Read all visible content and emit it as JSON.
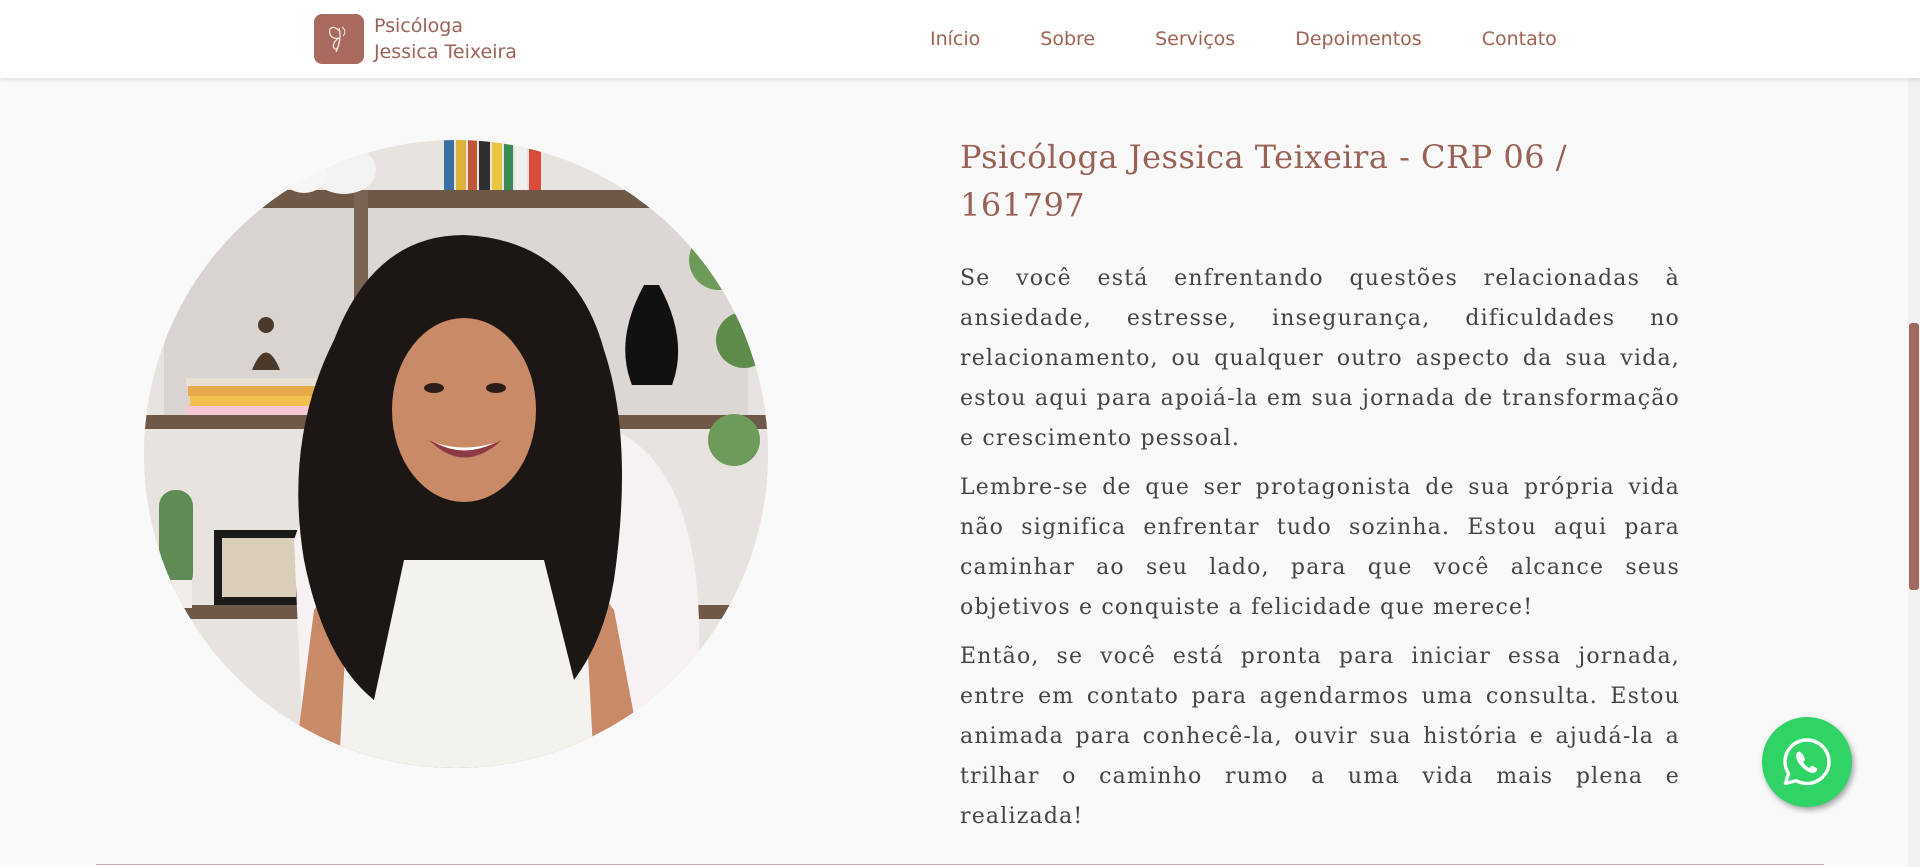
{
  "brand": {
    "line1": "Psicóloga",
    "line2": "Jessica Teixeira",
    "logo_icon": "butterfly-icon",
    "logo_color": "#a86a5e"
  },
  "nav": {
    "items": [
      {
        "label": "Início"
      },
      {
        "label": "Sobre"
      },
      {
        "label": "Serviços"
      },
      {
        "label": "Depoimentos"
      },
      {
        "label": "Contato"
      }
    ]
  },
  "main": {
    "title": "Psicóloga Jessica Teixeira - CRP 06 / 161797",
    "paragraphs": [
      "Se você está enfrentando questões relacionadas à ansiedade, estresse, insegurança, dificuldades no relacionamento, ou qualquer outro aspecto da sua vida, estou aqui para apoiá-la em sua jornada de transformação e crescimento pessoal.",
      "Lembre-se de que ser protagonista de sua própria vida não significa enfrentar tudo sozinha. Estou aqui para caminhar ao seu lado, para que você alcance seus objetivos e conquiste a felicidade que merece!",
      "Então, se você está pronta para iniciar essa jornada, entre em contato para agendarmos uma consulta. Estou animada para conhecê-la, ouvir sua história e ajudá-la a trilhar o caminho rumo a uma vida mais plena e realizada!"
    ]
  },
  "whatsapp": {
    "icon": "whatsapp-icon",
    "color": "#2fd366"
  },
  "colors": {
    "accent": "#9a6156",
    "background": "#f9f9f9"
  }
}
